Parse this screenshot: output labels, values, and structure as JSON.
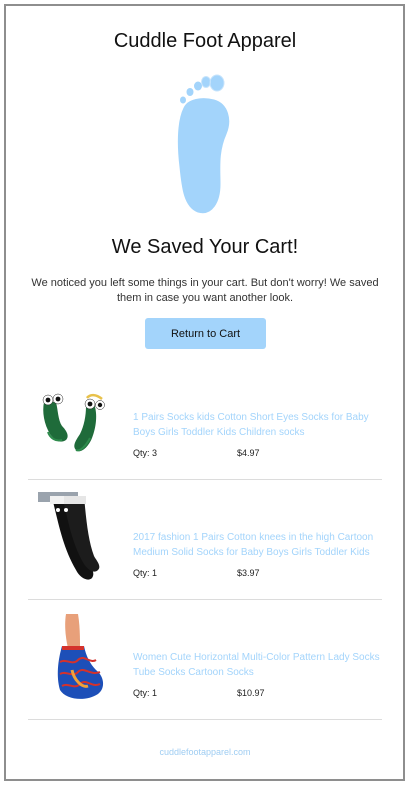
{
  "header": {
    "brand": "Cuddle Foot Apparel"
  },
  "logo": {
    "icon": "foot-icon",
    "color": "#a3d4fb"
  },
  "hero": {
    "headline": "We Saved Your Cart!",
    "message": "We noticed you left some things in your cart. But don't worry! We saved them in case you want another look.",
    "cta_label": "Return to Cart"
  },
  "products": [
    {
      "title": "1 Pairs Socks kids Cotton Short Eyes Socks for Baby Boys Girls Toddler Kids Children socks",
      "qty": "Qty: 3",
      "price": "$4.97",
      "image": "green-eye-socks"
    },
    {
      "title": "2017 fashion 1 Pairs Cotton knees in the high Cartoon Medium Solid Socks for Baby Boys Girls Toddler Kids",
      "qty": "Qty: 1",
      "price": "$3.97",
      "image": "black-knee-socks"
    },
    {
      "title": "Women Cute Horizontal Multi-Color Pattern Lady Socks Tube Socks Cartoon Socks",
      "qty": "Qty: 1",
      "price": "$10.97",
      "image": "striped-ankle-sock"
    }
  ],
  "footer": {
    "link": "cuddlefootapparel.com"
  },
  "colors": {
    "accent": "#a3d4fb",
    "link": "#a3d4fb"
  }
}
